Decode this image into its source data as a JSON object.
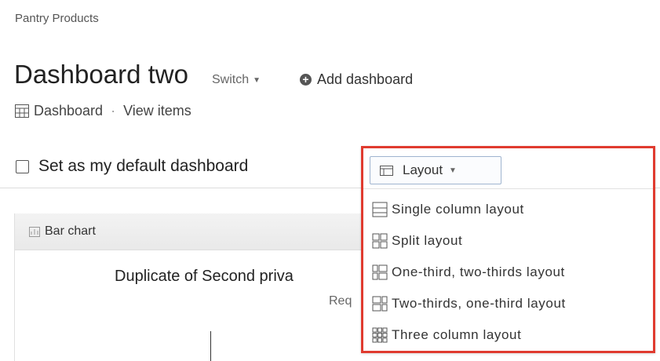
{
  "breadcrumb": "Pantry Products",
  "header": {
    "title": "Dashboard two",
    "switch_label": "Switch",
    "add_dashboard_label": "Add dashboard"
  },
  "subnav": {
    "dashboard_label": "Dashboard",
    "separator": "·",
    "view_items_label": "View items"
  },
  "default_checkbox": {
    "label": "Set as my default dashboard",
    "checked": false
  },
  "layout_dropdown": {
    "button_label": "Layout",
    "highlight_color": "#e03b2f",
    "options": [
      {
        "label": "Single column layout",
        "icon": "single-column-icon"
      },
      {
        "label": "Split layout",
        "icon": "split-layout-icon"
      },
      {
        "label": "One-third, two-thirds layout",
        "icon": "one-third-two-thirds-icon"
      },
      {
        "label": "Two-thirds, one-third layout",
        "icon": "two-thirds-one-third-icon"
      },
      {
        "label": "Three column layout",
        "icon": "three-column-icon"
      }
    ]
  },
  "panel": {
    "title": "Bar chart",
    "chart_heading": "Duplicate of Second priva",
    "chart_subheading": "Req"
  }
}
